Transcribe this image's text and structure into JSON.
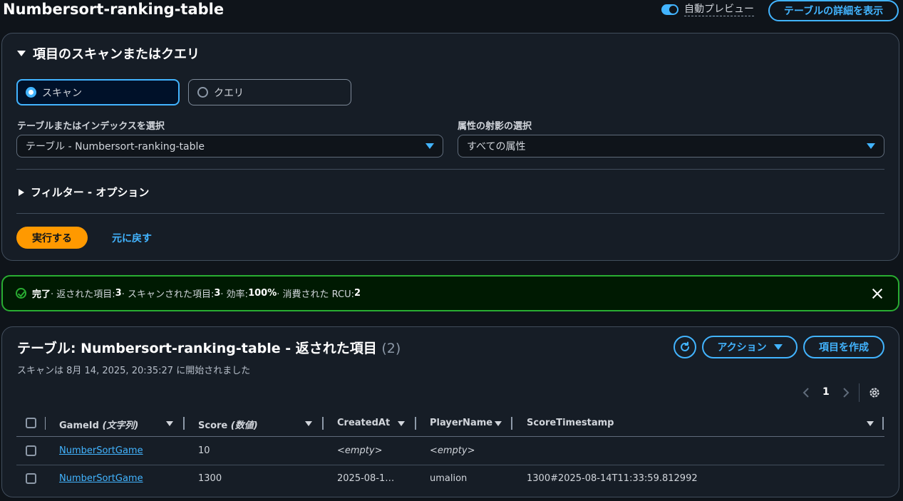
{
  "header": {
    "title": "Numbersort-ranking-table",
    "auto_preview_label": "自動プレビュー",
    "details_button": "テーブルの詳細を表示"
  },
  "scan_panel": {
    "title": "項目のスキャンまたはクエリ",
    "mode_scan": "スキャン",
    "mode_query": "クエリ",
    "selected_mode": "スキャン",
    "table_select_label": "テーブルまたはインデックスを選択",
    "table_select_value": "テーブル - Numbersort-ranking-table",
    "projection_label": "属性の射影の選択",
    "projection_value": "すべての属性",
    "filter_label": "フィルター - オプション",
    "run_button": "実行する",
    "reset_link": "元に戻す"
  },
  "alert": {
    "status": "完了",
    "returned_label": " · 返された項目: ",
    "returned_value": "3",
    "scanned_label": " · スキャンされた項目: ",
    "scanned_value": "3",
    "efficiency_label": " · 効率: ",
    "efficiency_value": "100%",
    "rcu_label": " · 消費された RCU: ",
    "rcu_value": "2"
  },
  "results": {
    "title": "テーブル: Numbersort-ranking-table - 返された項目",
    "count": "(2)",
    "subtitle": "スキャンは 8月 14, 2025, 20:35:27 に開始されました",
    "actions_button": "アクション",
    "create_button": "項目を作成",
    "page": "1",
    "columns": [
      {
        "name": "GameId",
        "type": "(文字列)"
      },
      {
        "name": "Score",
        "type": "(数値)"
      },
      {
        "name": "CreatedAt",
        "type": ""
      },
      {
        "name": "PlayerName",
        "type": ""
      },
      {
        "name": "ScoreTimestamp",
        "type": ""
      }
    ],
    "rows": [
      {
        "GameId": "NumberSortGame",
        "Score": "10",
        "CreatedAt": "<empty>",
        "PlayerName": "<empty>",
        "ScoreTimestamp": ""
      },
      {
        "GameId": "NumberSortGame",
        "Score": "1300",
        "CreatedAt": "2025-08-1…",
        "PlayerName": "umalion",
        "ScoreTimestamp": "1300#2025-08-14T11:33:59.812992"
      }
    ]
  },
  "colors": {
    "accent": "#42b4ff",
    "primary_button": "#ff9900",
    "success": "#29ad32",
    "background": "#0f141a"
  }
}
